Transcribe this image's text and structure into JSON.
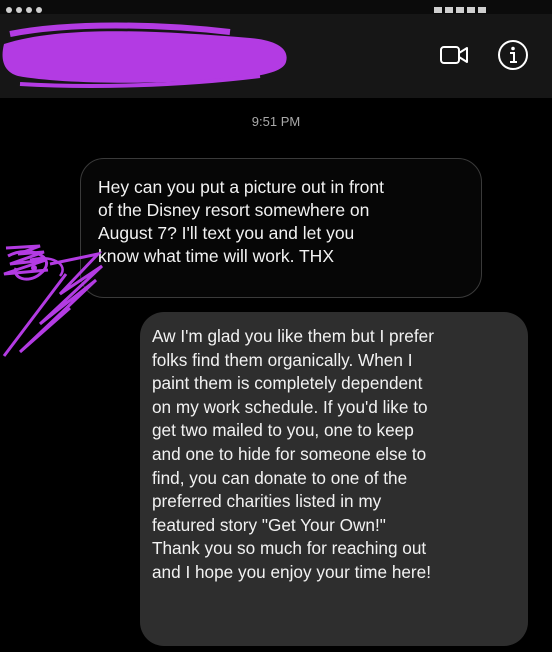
{
  "header": {
    "video_icon": "video-camera-icon",
    "info_icon": "info-circle-icon"
  },
  "colors": {
    "background": "#000000",
    "header": "#161616",
    "incoming_bubble": "#060606",
    "outgoing_bubble": "#2e2e2e",
    "redaction": "#b33be3"
  },
  "thread": {
    "timestamp": "9:51 PM",
    "messages": [
      {
        "direction": "incoming",
        "lines": [
          "Hey can you put a picture out in front",
          "of the Disney resort somewhere on",
          "August 7? I'll text you and let you",
          "know what time will work. THX"
        ]
      },
      {
        "direction": "outgoing",
        "lines": [
          "Aw I'm glad you like them but I prefer",
          "folks find them organically. When I",
          "paint them is completely dependent",
          "on my work schedule. If you'd like to",
          "get two mailed to you, one to keep",
          "and one to hide for someone else to",
          "find, you can donate to one of the",
          "preferred charities listed in my",
          "featured story \"Get Your Own!\"",
          "Thank you so much for reaching out",
          "and I hope you enjoy your time here!"
        ]
      }
    ]
  }
}
